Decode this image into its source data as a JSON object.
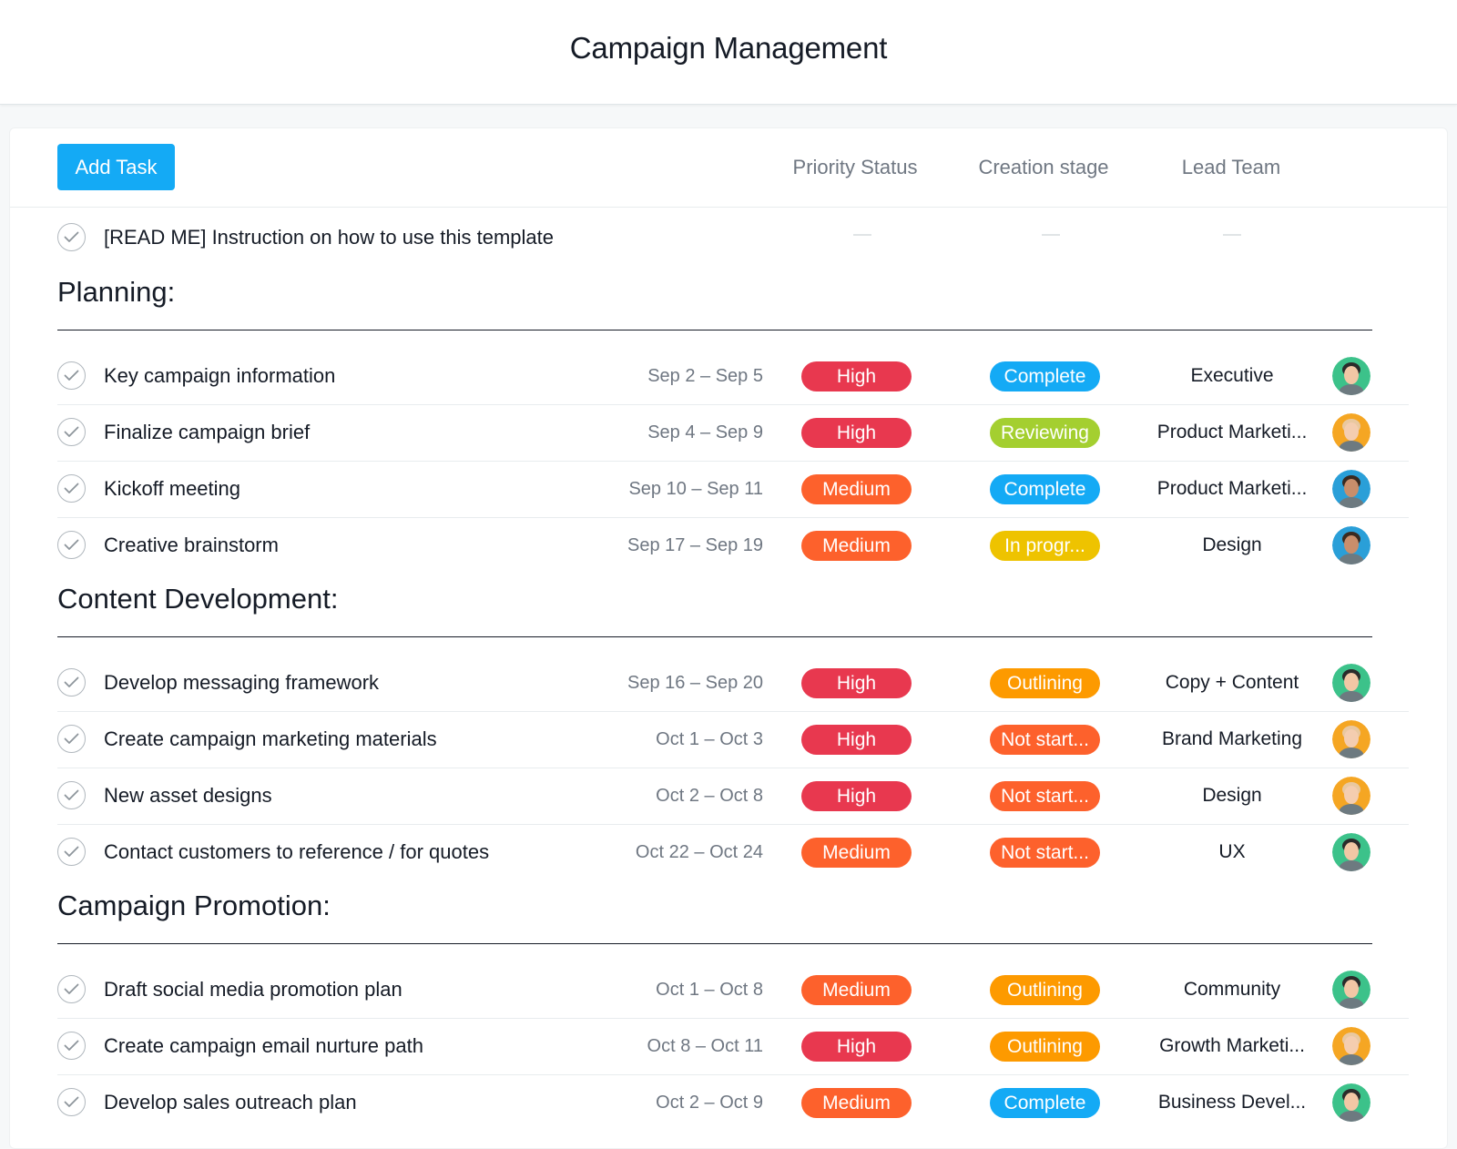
{
  "page": {
    "title": "Campaign Management"
  },
  "toolbar": {
    "add_task_label": "Add Task"
  },
  "columns": {
    "priority": "Priority Status",
    "stage": "Creation stage",
    "team": "Lead Team"
  },
  "readme": {
    "name": "[READ ME] Instruction on how to use this template"
  },
  "colors": {
    "High": "#e8384f",
    "Medium": "#fd612c",
    "Complete": "#14aaf5",
    "Reviewing": "#a4cf30",
    "In progr...": "#eec300",
    "Outlining": "#fd9a00",
    "Not start...": "#fd612c"
  },
  "sections": [
    {
      "title": "Planning:",
      "tasks": [
        {
          "name": "Key campaign information",
          "dates": "Sep 2 – Sep 5",
          "priority": "High",
          "stage": "Complete",
          "team": "Executive",
          "avatar": "avatar-green"
        },
        {
          "name": "Finalize campaign brief",
          "dates": "Sep 4 – Sep 9",
          "priority": "High",
          "stage": "Reviewing",
          "team": "Product Marketi...",
          "avatar": "avatar-orange"
        },
        {
          "name": "Kickoff meeting",
          "dates": "Sep 10 – Sep 11",
          "priority": "Medium",
          "stage": "Complete",
          "team": "Product Marketi...",
          "avatar": "avatar-blue"
        },
        {
          "name": "Creative brainstorm",
          "dates": "Sep 17 – Sep 19",
          "priority": "Medium",
          "stage": "In progr...",
          "team": "Design",
          "avatar": "avatar-blue"
        }
      ]
    },
    {
      "title": "Content Development:",
      "tasks": [
        {
          "name": "Develop messaging framework",
          "dates": "Sep 16 – Sep 20",
          "priority": "High",
          "stage": "Outlining",
          "team": "Copy + Content",
          "avatar": "avatar-green"
        },
        {
          "name": "Create campaign marketing materials",
          "dates": "Oct 1 – Oct 3",
          "priority": "High",
          "stage": "Not start...",
          "team": "Brand Marketing",
          "avatar": "avatar-orange"
        },
        {
          "name": "New asset designs",
          "dates": "Oct 2 – Oct 8",
          "priority": "High",
          "stage": "Not start...",
          "team": "Design",
          "avatar": "avatar-orange"
        },
        {
          "name": "Contact customers to reference / for quotes",
          "dates": "Oct 22 – Oct 24",
          "priority": "Medium",
          "stage": "Not start...",
          "team": "UX",
          "avatar": "avatar-green"
        }
      ]
    },
    {
      "title": "Campaign Promotion:",
      "tasks": [
        {
          "name": "Draft social media promotion plan",
          "dates": "Oct 1 – Oct 8",
          "priority": "Medium",
          "stage": "Outlining",
          "team": "Community",
          "avatar": "avatar-green"
        },
        {
          "name": "Create campaign email nurture path",
          "dates": "Oct 8 – Oct 11",
          "priority": "High",
          "stage": "Outlining",
          "team": "Growth Marketi...",
          "avatar": "avatar-orange"
        },
        {
          "name": "Develop sales outreach plan",
          "dates": "Oct 2 – Oct 9",
          "priority": "Medium",
          "stage": "Complete",
          "team": "Business Devel...",
          "avatar": "avatar-green"
        }
      ]
    }
  ]
}
